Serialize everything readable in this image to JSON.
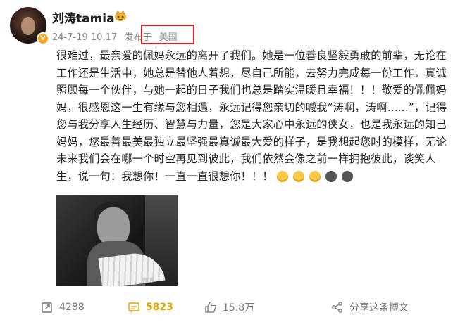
{
  "post": {
    "username": "刘涛tamia",
    "date": "24-7-19 10:17",
    "posted_from_label": "发布于",
    "location": "美国",
    "text": "很难过，最亲爱的佩妈永远的离开了我们。她是一位善良坚毅勇敢的前辈，无论在工作还是生活中，她总是替他人着想，尽自己所能，去努力完成每一份工作，真诚照顾每一个伙伴，与她一起的日子我们也总是踏实温暖且幸福！！！敬爱的佩佩妈妈，很感恩这一生有缘与您相遇，永远记得您亲切的喊我“涛啊，涛啊......”，记得您与我分享人生经历、智慧与力量，您是大家心中永远的侠女，也是我永远的知己妈妈，您最善最美最独立最坚强最真诚最大爱的样子，是我想起您时的模样，无论未来我们会在哪一个时空再见到彼此，我们依然会像之前一样拥抱彼此，谈笑人生，说一句：我想你！一直一直很想你！！！",
    "emojis": [
      "hug-emoji",
      "hug-emoji",
      "hug-emoji",
      "cry-emoji",
      "cry-emoji"
    ],
    "image_watermark": "微博"
  },
  "actions": {
    "repost_count": "4288",
    "comment_count": "5823",
    "like_count": "15.8万",
    "share_label": "分享这条博文"
  },
  "colors": {
    "highlight_box": "#e02020",
    "comment_accent": "#e6a400",
    "verified_badge": "#f5a623"
  }
}
